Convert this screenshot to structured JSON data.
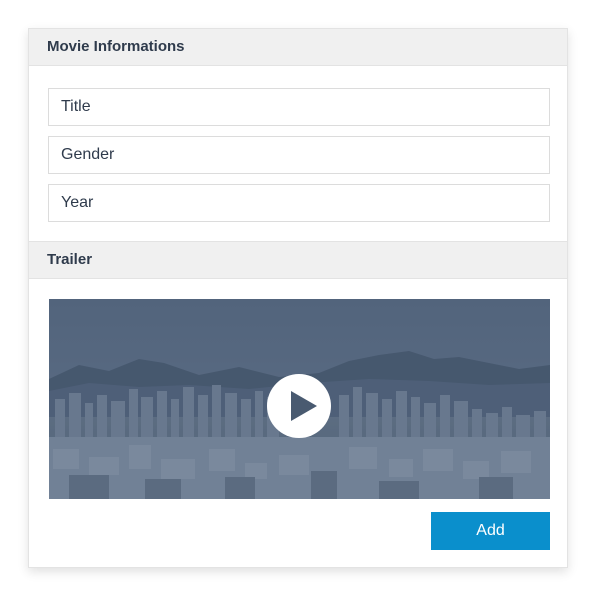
{
  "movie_section": {
    "title": "Movie Informations",
    "fields": [
      {
        "placeholder": "Title",
        "value": ""
      },
      {
        "placeholder": "Gender",
        "value": ""
      },
      {
        "placeholder": "Year",
        "value": ""
      }
    ]
  },
  "trailer_section": {
    "title": "Trailer",
    "video": {
      "thumbnail": "city skyline with mountains",
      "overlay_color": "#3f5069",
      "play_icon": "play-icon"
    }
  },
  "actions": {
    "add_label": "Add",
    "add_color": "#0a8fcc"
  }
}
